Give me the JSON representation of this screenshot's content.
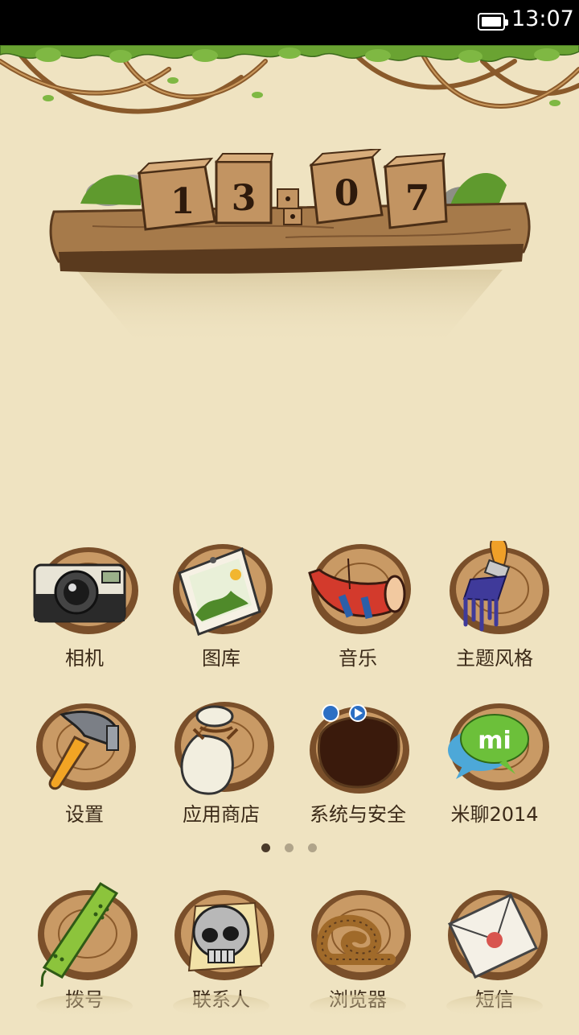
{
  "status_bar": {
    "time": "13:07",
    "battery_icon": "battery-full-icon"
  },
  "clock_widget": {
    "digits": [
      "1",
      "3",
      "0",
      "7"
    ]
  },
  "apps": [
    {
      "label": "相机",
      "icon": "camera-icon"
    },
    {
      "label": "图库",
      "icon": "gallery-icon"
    },
    {
      "label": "音乐",
      "icon": "music-horn-icon"
    },
    {
      "label": "主题风格",
      "icon": "paintbrush-icon"
    },
    {
      "label": "设置",
      "icon": "hammer-icon"
    },
    {
      "label": "应用商店",
      "icon": "sack-icon"
    },
    {
      "label": "系统与安全",
      "icon": "security-hole-icon"
    },
    {
      "label": "米聊2014",
      "icon": "mi-chat-icon"
    }
  ],
  "page_indicator": {
    "count": 3,
    "active": 0
  },
  "dock": [
    {
      "label": "拨号",
      "icon": "phone-handset-icon"
    },
    {
      "label": "联系人",
      "icon": "skull-contacts-icon"
    },
    {
      "label": "浏览器",
      "icon": "snail-browser-icon"
    },
    {
      "label": "短信",
      "icon": "envelope-icon"
    }
  ],
  "colors": {
    "background": "#efe3c1",
    "wood": "#a2713f",
    "wood_dark": "#5a3a1e",
    "leaf": "#5f9a2e",
    "label": "#3b2a18"
  }
}
